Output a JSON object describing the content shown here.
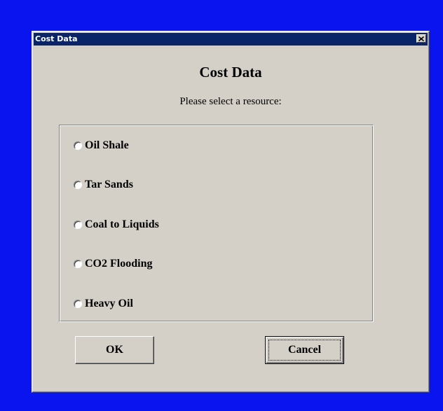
{
  "window": {
    "title": "Cost Data",
    "close_glyph": "✕"
  },
  "dialog": {
    "heading": "Cost Data",
    "prompt": "Please select a resource:"
  },
  "resources": [
    {
      "label": "Oil Shale",
      "selected": false
    },
    {
      "label": "Tar Sands",
      "selected": false
    },
    {
      "label": "Coal to Liquids",
      "selected": false
    },
    {
      "label": "CO2 Flooding",
      "selected": false
    },
    {
      "label": "Heavy Oil",
      "selected": false
    }
  ],
  "buttons": {
    "ok_label": "OK",
    "cancel_label": "Cancel",
    "focused": "cancel"
  },
  "colors": {
    "desktop": "#0a14ee",
    "titlebar": "#0a246a",
    "face": "#d4d0c8"
  },
  "icons": {
    "close": "close-icon",
    "radio": "radio-button-icon"
  }
}
